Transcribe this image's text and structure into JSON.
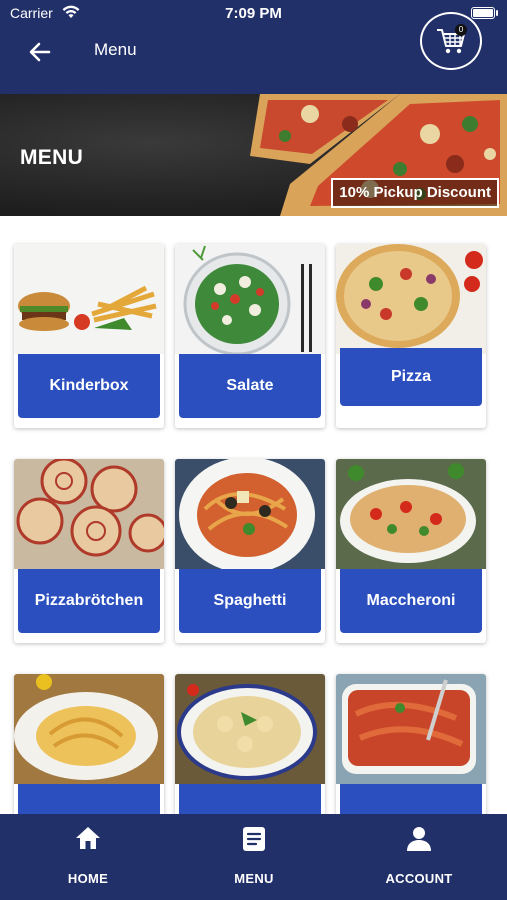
{
  "status_bar": {
    "carrier": "Carrier",
    "time": "7:09 PM"
  },
  "nav": {
    "title": "Menu",
    "back_icon": "arrow-left-icon",
    "cart_icon": "shopping-cart-icon",
    "cart_count": "0"
  },
  "banner": {
    "title": "MENU",
    "discount": "10% Pickup Discount"
  },
  "categories": [
    {
      "label": "Kinderbox"
    },
    {
      "label": "Salate"
    },
    {
      "label": "Pizza"
    },
    {
      "label": "Pizzabrötchen"
    },
    {
      "label": "Spaghetti"
    },
    {
      "label": "Maccheroni"
    },
    {
      "label": ""
    },
    {
      "label": ""
    },
    {
      "label": ""
    }
  ],
  "tabs": [
    {
      "label": "HOME",
      "icon": "home-icon"
    },
    {
      "label": "MENU",
      "icon": "menu-document-icon"
    },
    {
      "label": "ACCOUNT",
      "icon": "user-icon"
    }
  ],
  "colors": {
    "header": "#22306a",
    "accent": "#2b4fbf"
  }
}
